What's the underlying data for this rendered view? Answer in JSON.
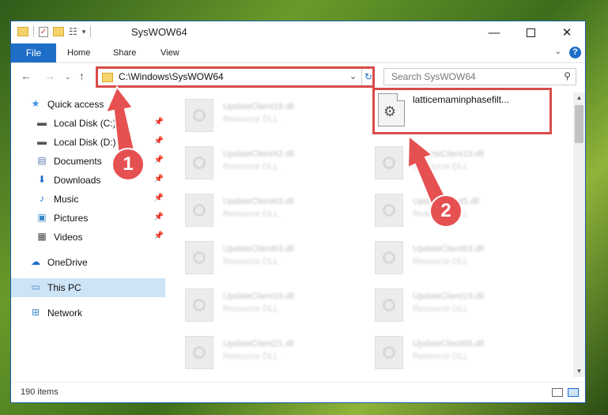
{
  "window": {
    "title": "SysWOW64",
    "controls": {
      "minimize": "—",
      "maximize": "",
      "close": "✕"
    }
  },
  "quick_access_toolbar": {
    "props_glyph": "☷",
    "dropdown_glyph": "▾",
    "check_glyph": "✓"
  },
  "ribbon": {
    "tabs": [
      "File",
      "Home",
      "Share",
      "View"
    ],
    "chevron": "⌄",
    "help": "?"
  },
  "navbar": {
    "back": "←",
    "forward": "→",
    "recent": "⌄",
    "up": "↑",
    "address": "C:\\Windows\\SysWOW64",
    "address_dropdown": "⌄",
    "refresh": "↻",
    "search_placeholder": "Search SysWOW64",
    "search_glyph": "⚲"
  },
  "sidebar": {
    "items": [
      {
        "label": "Quick access",
        "icon": "star-icon",
        "glyph": "★",
        "color": "#3c8ee0",
        "pinned": false
      },
      {
        "label": "Local Disk (C:)",
        "icon": "drive-icon",
        "glyph": "▬",
        "color": "#555555",
        "pinned": true
      },
      {
        "label": "Local Disk (D:)",
        "icon": "drive-icon",
        "glyph": "▬",
        "color": "#555555",
        "pinned": true
      },
      {
        "label": "Documents",
        "icon": "document-icon",
        "glyph": "▤",
        "color": "#5a7ea8",
        "pinned": true
      },
      {
        "label": "Downloads",
        "icon": "download-icon",
        "glyph": "⬇",
        "color": "#1e6ec8",
        "pinned": true
      },
      {
        "label": "Music",
        "icon": "music-icon",
        "glyph": "♪",
        "color": "#1e6ec8",
        "pinned": true
      },
      {
        "label": "Pictures",
        "icon": "pictures-icon",
        "glyph": "▣",
        "color": "#3a86c8",
        "pinned": true
      },
      {
        "label": "Videos",
        "icon": "video-icon",
        "glyph": "▦",
        "color": "#444444",
        "pinned": true
      },
      {
        "label": "OneDrive",
        "icon": "cloud-icon",
        "glyph": "☁",
        "color": "#1e6ec8",
        "pinned": false
      },
      {
        "label": "This PC",
        "icon": "computer-icon",
        "glyph": "▭",
        "color": "#3a86c8",
        "pinned": false,
        "selected": true
      },
      {
        "label": "Network",
        "icon": "network-icon",
        "glyph": "⊞",
        "color": "#3a86c8",
        "pinned": false
      }
    ],
    "pin_glyph": "📌"
  },
  "files": {
    "target": {
      "name": "latticemaminphasefilt...",
      "icon": "gear-file-icon",
      "glyph": "⚙"
    },
    "left_column": [
      {
        "name": "UpdateClient19.dll",
        "type": "Resource DLL"
      },
      {
        "name": "UpdateClient42.dll",
        "type": "Resource DLL"
      },
      {
        "name": "UpdateClient63.dll",
        "type": "Resource DLL"
      },
      {
        "name": "UpdateClient63.dll",
        "type": "Resource DLL"
      },
      {
        "name": "UpdateClient19.dll",
        "type": "Resource DLL"
      },
      {
        "name": "UpdateClient21.dll",
        "type": "Resource DLL"
      }
    ],
    "right_column": [
      {
        "name": "UpdateClient19.dll",
        "type": "Resource DLL"
      },
      {
        "name": "UpdateClient5.dll",
        "type": "Resource DLL"
      },
      {
        "name": "UpdateClient63.dll",
        "type": "Resource DLL"
      },
      {
        "name": "UpdateClient19.dll",
        "type": "Resource DLL"
      },
      {
        "name": "UpdateClient65.dll",
        "type": "Resource DLL"
      }
    ]
  },
  "scrollbar": {
    "up": "▲",
    "down": "▼"
  },
  "status": {
    "item_count": "190 items"
  },
  "annotations": {
    "step1": "1",
    "step2": "2",
    "accent": "#e55050"
  }
}
